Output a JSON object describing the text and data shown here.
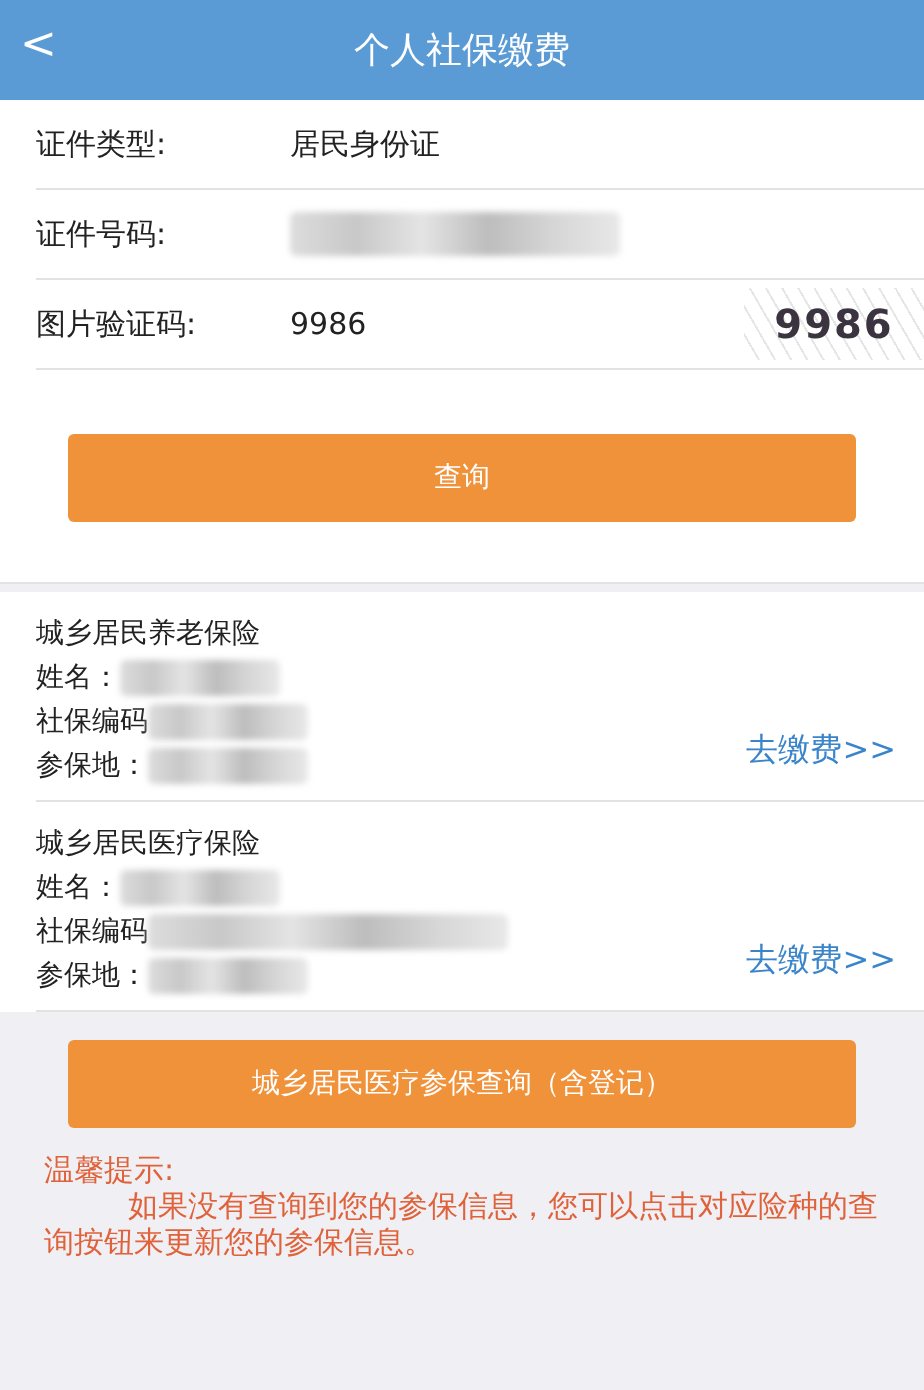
{
  "header": {
    "back": "<",
    "title": "个人社保缴费"
  },
  "form": [
    {
      "kind": "text",
      "label": "证件类型:",
      "value": "居民身份证"
    },
    {
      "kind": "redacted",
      "label": "证件号码:"
    },
    {
      "kind": "captcha",
      "label": "图片验证码:",
      "value": "9986",
      "captcha": "9986"
    }
  ],
  "query_button": "查询",
  "results": [
    {
      "title": "城乡居民养老保险",
      "lines": [
        "姓名：",
        "社保编码",
        "参保地："
      ],
      "action": "去缴费>>"
    },
    {
      "title": "城乡居民医疗保险",
      "lines": [
        "姓名：",
        "社保编码",
        "参保地："
      ],
      "action": "去缴费>>"
    }
  ],
  "medical_button": "城乡居民医疗参保查询（含登记）",
  "tip": {
    "heading": "温馨提示:",
    "body": "如果没有查询到您的参保信息，您可以点击对应险种的查询按钮来更新您的参保信息。"
  }
}
